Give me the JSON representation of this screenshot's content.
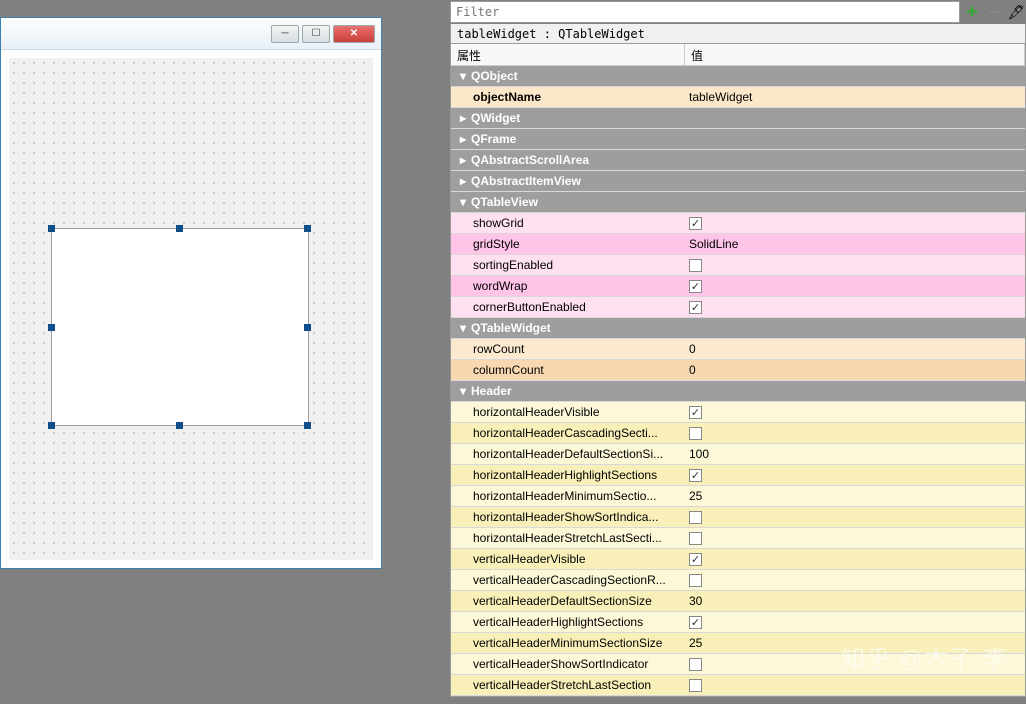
{
  "filter": {
    "placeholder": "Filter"
  },
  "objectClass": "tableWidget : QTableWidget",
  "header": {
    "property": "属性",
    "value": "值"
  },
  "groups": {
    "qobject": "QObject",
    "qwidget": "QWidget",
    "qframe": "QFrame",
    "qabstractscrollarea": "QAbstractScrollArea",
    "qabstractitemview": "QAbstractItemView",
    "qtableview": "QTableView",
    "qtablewidget": "QTableWidget",
    "header": "Header"
  },
  "props": {
    "objectName": {
      "label": "objectName",
      "value": "tableWidget"
    },
    "showGrid": {
      "label": "showGrid",
      "checked": true
    },
    "gridStyle": {
      "label": "gridStyle",
      "value": "SolidLine"
    },
    "sortingEnabled": {
      "label": "sortingEnabled",
      "checked": false
    },
    "wordWrap": {
      "label": "wordWrap",
      "checked": true
    },
    "cornerButtonEnabled": {
      "label": "cornerButtonEnabled",
      "checked": true
    },
    "rowCount": {
      "label": "rowCount",
      "value": "0"
    },
    "columnCount": {
      "label": "columnCount",
      "value": "0"
    },
    "horizontalHeaderVisible": {
      "label": "horizontalHeaderVisible",
      "checked": true
    },
    "horizontalHeaderCascadingSectionResizes": {
      "label": "horizontalHeaderCascadingSecti...",
      "checked": false
    },
    "horizontalHeaderDefaultSectionSize": {
      "label": "horizontalHeaderDefaultSectionSi...",
      "value": "100"
    },
    "horizontalHeaderHighlightSections": {
      "label": "horizontalHeaderHighlightSections",
      "checked": true
    },
    "horizontalHeaderMinimumSectionSize": {
      "label": "horizontalHeaderMinimumSectio...",
      "value": "25"
    },
    "horizontalHeaderShowSortIndicator": {
      "label": "horizontalHeaderShowSortIndica...",
      "checked": false
    },
    "horizontalHeaderStretchLastSection": {
      "label": "horizontalHeaderStretchLastSecti...",
      "checked": false
    },
    "verticalHeaderVisible": {
      "label": "verticalHeaderVisible",
      "checked": true
    },
    "verticalHeaderCascadingSectionResizes": {
      "label": "verticalHeaderCascadingSectionR...",
      "checked": false
    },
    "verticalHeaderDefaultSectionSize": {
      "label": "verticalHeaderDefaultSectionSize",
      "value": "30"
    },
    "verticalHeaderHighlightSections": {
      "label": "verticalHeaderHighlightSections",
      "checked": true
    },
    "verticalHeaderMinimumSectionSize": {
      "label": "verticalHeaderMinimumSectionSize",
      "value": "25"
    },
    "verticalHeaderShowSortIndicator": {
      "label": "verticalHeaderShowSortIndicator",
      "checked": false
    },
    "verticalHeaderStretchLastSection": {
      "label": "verticalHeaderStretchLastSection",
      "checked": false
    }
  },
  "watermark": "知乎 @木子-李"
}
